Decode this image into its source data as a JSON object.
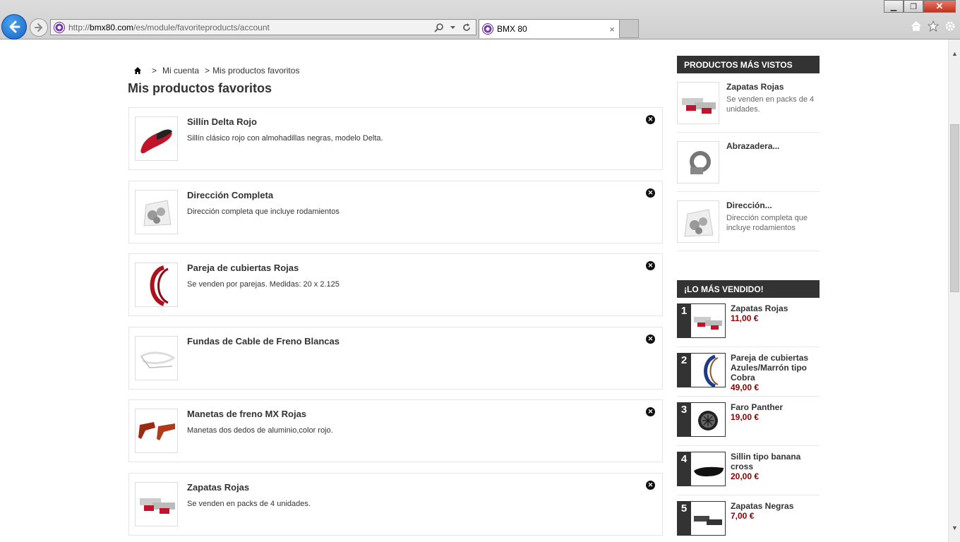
{
  "browser": {
    "url_prefix": "http://",
    "url_domain": "bmx80.com",
    "url_path": "/es/module/favoriteproducts/account",
    "tab_title": "BMX 80",
    "tab_close": "×",
    "min": "▁",
    "restore": "❐",
    "close": "✕"
  },
  "breadcrumb": {
    "home_icon": "home-icon",
    "sep1": ">",
    "item1": "Mi cuenta",
    "sep2": ">",
    "item2": "Mis productos favoritos"
  },
  "page_title": "Mis productos favoritos",
  "favorites": [
    {
      "title": "Sillín Delta Rojo",
      "desc": "Sillín clásico rojo con almohadillas negras, modelo Delta."
    },
    {
      "title": "Dirección Completa",
      "desc": "Dirección completa que incluye rodamientos"
    },
    {
      "title": "Pareja de cubiertas Rojas",
      "desc": "Se venden por parejas. Medidas: 20 x 2.125"
    },
    {
      "title": "Fundas de Cable de Freno Blancas",
      "desc": ""
    },
    {
      "title": "Manetas de freno MX Rojas",
      "desc": "Manetas dos dedos de aluminio,color rojo."
    },
    {
      "title": "Zapatas Rojas",
      "desc": "Se venden en packs de 4 unidades."
    }
  ],
  "delete_glyph": "✕",
  "sidebar": {
    "viewed_title": "PRODUCTOS MÁS VISTOS",
    "viewed": [
      {
        "title": "Zapatas Rojas",
        "desc": "Se venden en packs de 4 unidades."
      },
      {
        "title": "Abrazadera...",
        "desc": ""
      },
      {
        "title": "Dirección...",
        "desc": "Dirección completa que incluye rodamientos"
      }
    ],
    "best_title": "¡LO MÁS VENDIDO!",
    "best": [
      {
        "rank": "1",
        "title": "Zapatas Rojas",
        "price": "11,00 €"
      },
      {
        "rank": "2",
        "title": "Pareja de cubiertas Azules/Marrón tipo Cobra",
        "price": "49,00 €"
      },
      {
        "rank": "3",
        "title": "Faro Panther",
        "price": "19,00 €"
      },
      {
        "rank": "4",
        "title": "Sillin tipo banana cross",
        "price": "20,00 €"
      },
      {
        "rank": "5",
        "title": "Zapatas Negras",
        "price": "7,00 €"
      }
    ]
  },
  "colors": {
    "price": "#8b0000",
    "header_bg": "#333333"
  }
}
